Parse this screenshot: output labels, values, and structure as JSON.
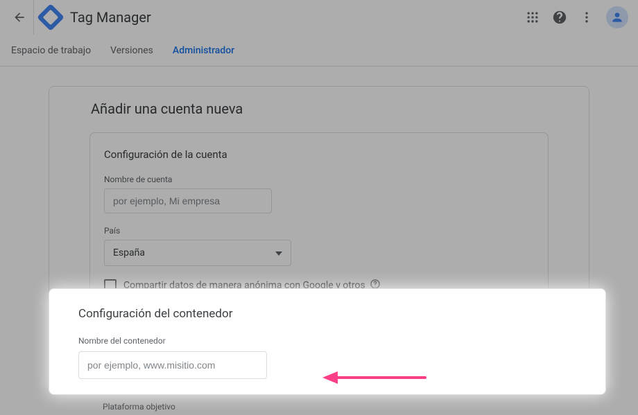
{
  "header": {
    "app_title": "Tag Manager"
  },
  "tabs": {
    "items": [
      {
        "label": "Espacio de trabajo",
        "active": false
      },
      {
        "label": "Versiones",
        "active": false
      },
      {
        "label": "Administrador",
        "active": true
      }
    ]
  },
  "page": {
    "title": "Añadir una cuenta nueva"
  },
  "account": {
    "section_title": "Configuración de la cuenta",
    "name_label": "Nombre de cuenta",
    "name_placeholder": "por ejemplo, Mi empresa",
    "country_label": "País",
    "country_value": "España",
    "share_label": "Compartir datos de manera anónima con Google y otros"
  },
  "container": {
    "section_title": "Configuración del contenedor",
    "name_label": "Nombre del contenedor",
    "name_placeholder": "por ejemplo, www.misitio.com",
    "platform_label": "Plataforma objetivo"
  },
  "colors": {
    "accent": "#1a73e8",
    "annotation_arrow": "#ff3e88"
  }
}
